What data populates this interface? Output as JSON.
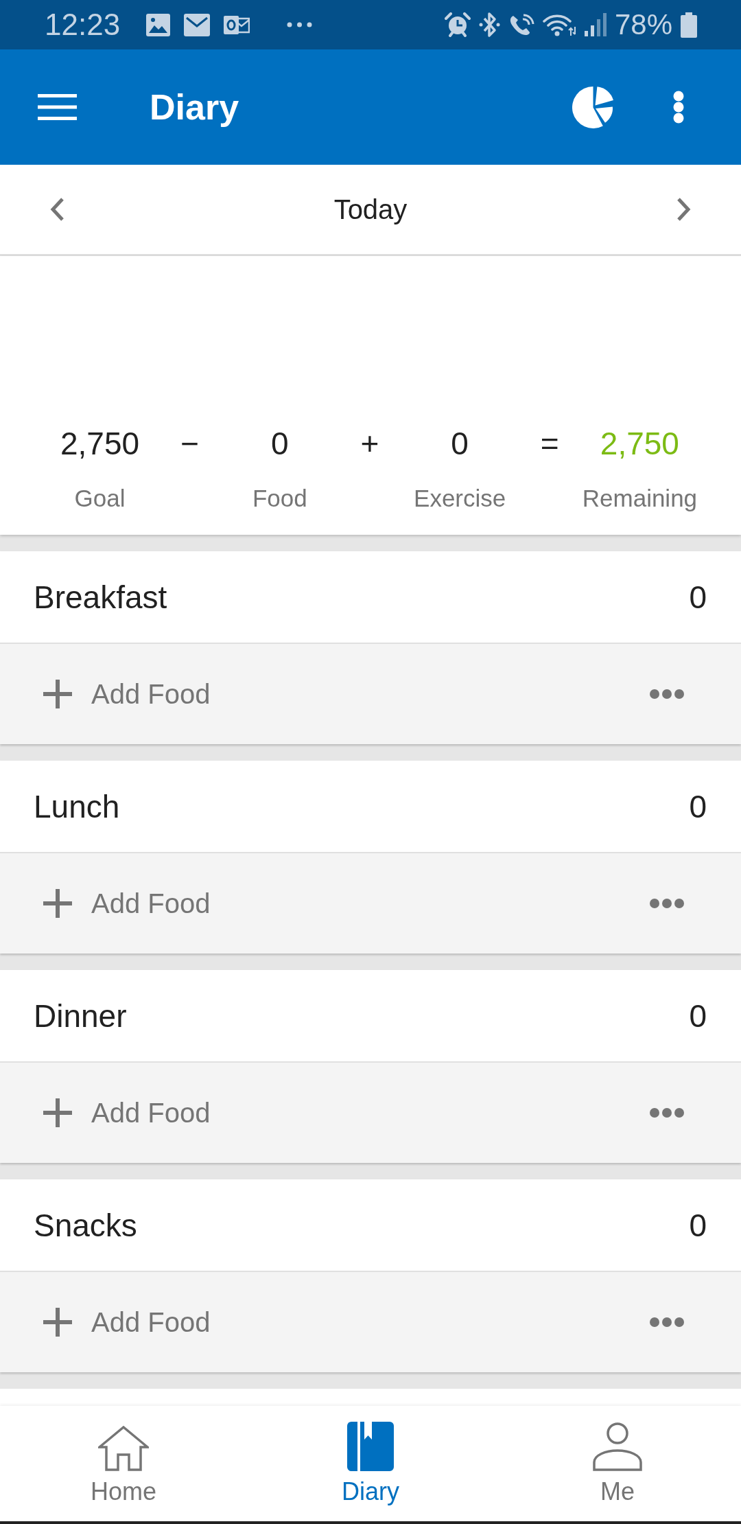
{
  "status_bar": {
    "time": "12:23",
    "battery": "78%"
  },
  "app_bar": {
    "title": "Diary"
  },
  "date_nav": {
    "label": "Today"
  },
  "summary": [
    {
      "kind": "term",
      "value": "2,750",
      "label": "Goal"
    },
    {
      "kind": "operator",
      "symbol": "−"
    },
    {
      "kind": "term",
      "value": "0",
      "label": "Food"
    },
    {
      "kind": "operator",
      "symbol": "+"
    },
    {
      "kind": "term",
      "value": "0",
      "label": "Exercise"
    },
    {
      "kind": "operator",
      "symbol": "="
    },
    {
      "kind": "result",
      "value": "2,750",
      "label": "Remaining"
    }
  ],
  "meals": [
    {
      "name": "Breakfast",
      "calories": "0",
      "action": "Add Food"
    },
    {
      "name": "Lunch",
      "calories": "0",
      "action": "Add Food"
    },
    {
      "name": "Dinner",
      "calories": "0",
      "action": "Add Food"
    },
    {
      "name": "Snacks",
      "calories": "0",
      "action": "Add Food"
    }
  ],
  "bottom_nav": [
    {
      "kind": "home",
      "label": "Home",
      "selected": false
    },
    {
      "kind": "diary",
      "label": "Diary",
      "selected": true
    },
    {
      "kind": "profile",
      "label": "Me",
      "selected": false
    }
  ]
}
